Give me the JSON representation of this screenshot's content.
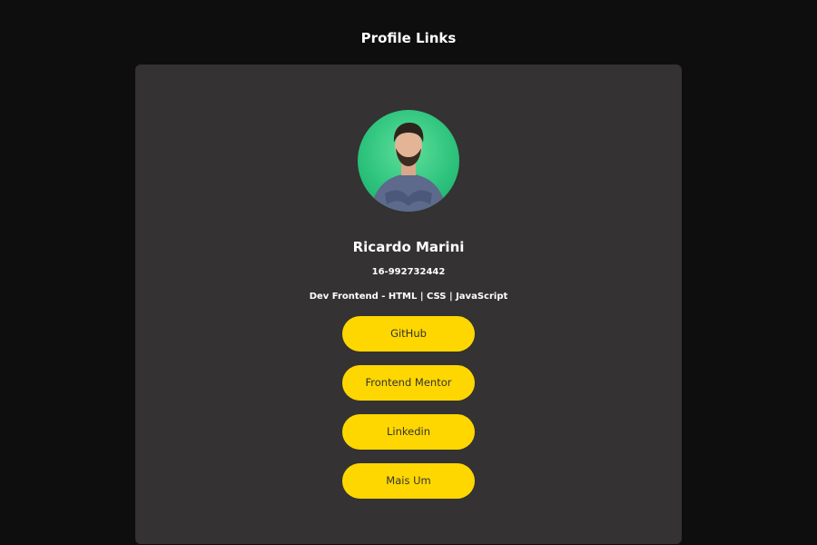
{
  "header": {
    "title": "Profile Links"
  },
  "profile": {
    "avatar_icon": "profile-photo",
    "name": "Ricardo Marini",
    "phone": "16-992732442",
    "role": "Dev Frontend - HTML | CSS | JavaScript"
  },
  "links": [
    {
      "label": "GitHub"
    },
    {
      "label": "Frontend Mentor"
    },
    {
      "label": "Linkedin"
    },
    {
      "label": "Mais Um"
    }
  ],
  "colors": {
    "background": "#0e0e0e",
    "card": "#343232",
    "button": "#ffd700",
    "button_text": "#333333",
    "avatar_bg": "#2fc47e"
  }
}
